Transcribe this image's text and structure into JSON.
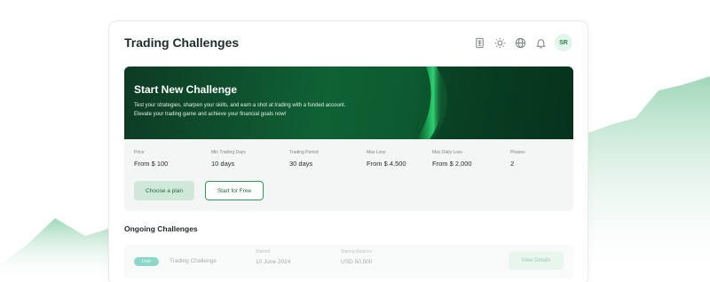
{
  "header": {
    "title": "Trading Challenges",
    "icons": [
      "calculator-icon",
      "sun-icon",
      "globe-icon",
      "bell-icon"
    ],
    "avatar_initials": "SR"
  },
  "promo": {
    "title": "Start New Challenge",
    "subtitle_line1": "Test your strategies, sharpen your skills, and earn a shot at trading with a funded account.",
    "subtitle_line2": "Elevate your trading game and achieve your financial goals now!",
    "stats": [
      {
        "label": "Price",
        "value": "From $ 100"
      },
      {
        "label": "Min Trading Days",
        "value": "10 days"
      },
      {
        "label": "Trading Period",
        "value": "30 days"
      },
      {
        "label": "Max Loss",
        "value": "From $ 4,500"
      },
      {
        "label": "Max Daily Loss",
        "value": "From $ 2,000"
      },
      {
        "label": "Phases",
        "value": "2"
      }
    ],
    "choose_plan_label": "Choose a plan",
    "start_free_label": "Start for Free"
  },
  "ongoing": {
    "title": "Ongoing Challenges",
    "rows": [
      {
        "status": "Live",
        "name": "Trading Challenge",
        "started_label": "Started",
        "started_value": "10 June 2024",
        "balance_label": "Staring Balance",
        "balance_value": "USD 50,000",
        "details_label": "View Details"
      }
    ]
  },
  "colors": {
    "accent": "#1e8a45",
    "hero_dark": "#0e3a24",
    "live_badge": "#2fb8a0"
  }
}
